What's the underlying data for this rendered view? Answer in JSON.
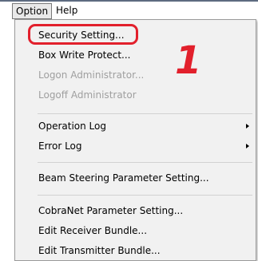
{
  "menubar": {
    "items": [
      {
        "label": "Option"
      },
      {
        "label": "Help"
      }
    ]
  },
  "dropdown": {
    "items": [
      {
        "label": "Security Setting...",
        "enabled": true
      },
      {
        "label": "Box Write Protect...",
        "enabled": true
      },
      {
        "label": "Logon Administrator...",
        "enabled": false
      },
      {
        "label": "Logoff Administrator",
        "enabled": false
      },
      {
        "label": "Operation Log",
        "enabled": true,
        "submenu": true
      },
      {
        "label": "Error Log",
        "enabled": true,
        "submenu": true
      },
      {
        "label": "Beam Steering Parameter Setting...",
        "enabled": true
      },
      {
        "label": "CobraNet Parameter Setting...",
        "enabled": true
      },
      {
        "label": "Edit Receiver Bundle...",
        "enabled": true
      },
      {
        "label": "Edit Transmitter Bundle...",
        "enabled": true
      }
    ]
  },
  "annotation": {
    "step_number": "1",
    "color": "#e2202c"
  }
}
